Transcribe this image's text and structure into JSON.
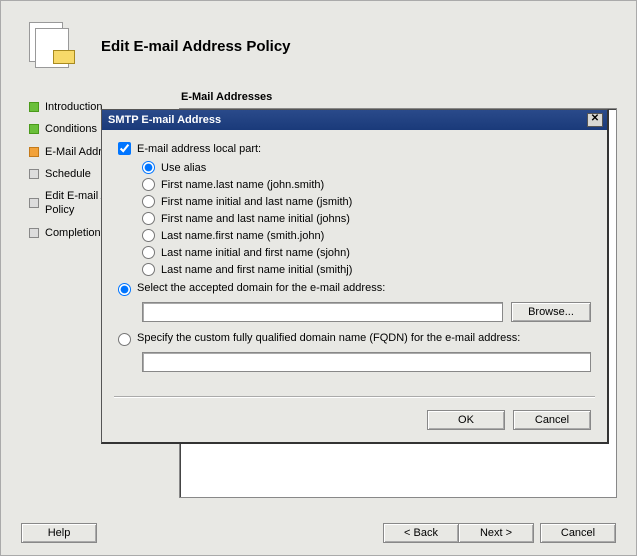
{
  "header": {
    "title": "Edit E-mail Address Policy"
  },
  "steps": {
    "items": [
      {
        "label": "Introduction",
        "state": "done"
      },
      {
        "label": "Conditions",
        "state": "done"
      },
      {
        "label": "E-Mail Addresses",
        "state": "current"
      },
      {
        "label": "Schedule",
        "state": "pending"
      },
      {
        "label": "Edit E-mail Address Policy",
        "state": "pending"
      },
      {
        "label": "Completion",
        "state": "pending"
      }
    ]
  },
  "section": {
    "heading": "E-Mail Addresses"
  },
  "wizardButtons": {
    "help": "Help",
    "back": "< Back",
    "next": "Next >",
    "cancel": "Cancel"
  },
  "dialog": {
    "title": "SMTP E-mail Address",
    "localPartLabel": "E-mail address local part:",
    "options": [
      "Use alias",
      "First name.last name (john.smith)",
      "First name initial and last name (jsmith)",
      "First name and last name initial (johns)",
      "Last name.first name (smith.john)",
      "Last name initial and first name (sjohn)",
      "Last name and first name initial (smithj)"
    ],
    "selectAcceptedDomain": "Select the accepted domain for the e-mail address:",
    "browse": "Browse...",
    "specifyFqdn": "Specify the custom fully qualified domain name (FQDN) for the e-mail address:",
    "acceptedDomainValue": "",
    "fqdnValue": "",
    "ok": "OK",
    "cancel": "Cancel"
  }
}
